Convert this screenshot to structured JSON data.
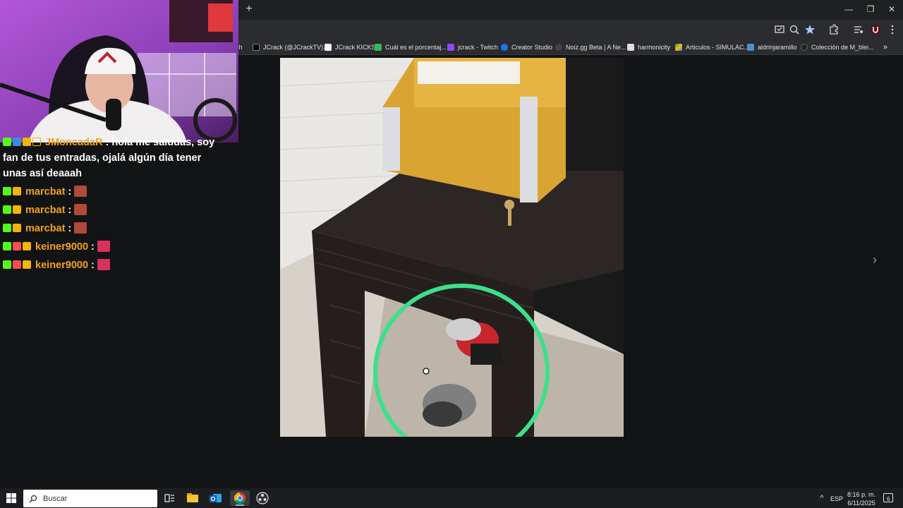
{
  "browser": {
    "new_tab_label": "+",
    "window_controls": {
      "minimize": "—",
      "restore": "❐",
      "close": "✕"
    },
    "toolbar_icons": [
      "cast-icon",
      "zoom-icon",
      "bookmark-star-icon",
      "extensions-icon",
      "media-icon",
      "profile-icon",
      "menu-icon"
    ],
    "bookmarks": [
      {
        "label": "ch",
        "icon": "twitch-icon"
      },
      {
        "label": "JCrack (@JCrackTV)...",
        "icon": "x-icon"
      },
      {
        "label": "JCrack KICKS",
        "icon": "kick-icon"
      },
      {
        "label": "Cuál es el porcentaj...",
        "icon": "page-icon"
      },
      {
        "label": "jcrack - Twitch",
        "icon": "twitch-icon"
      },
      {
        "label": "Creator Studio",
        "icon": "facebook-icon"
      },
      {
        "label": "Noiz.gg Beta | A Ne...",
        "icon": "noiz-icon"
      },
      {
        "label": "harmonicity",
        "icon": "page-icon"
      },
      {
        "label": "Articulos - SIMULAC...",
        "icon": "drive-icon"
      },
      {
        "label": "aldrinjaramillo",
        "icon": "page-icon"
      },
      {
        "label": "Colección de M_blei...",
        "icon": "page-icon"
      }
    ],
    "bookmarks_overflow": "»"
  },
  "viewer": {
    "next_label": "›"
  },
  "chat": {
    "messages": [
      {
        "user": "JMoncadaR",
        "separator": " : ",
        "text": "hola me saludas, soy"
      },
      {
        "continuation": "fan de tus entradas, ojalá algún día tener"
      },
      {
        "continuation": "unas así deaaah"
      },
      {
        "user": "marcbat",
        "separator": " : "
      },
      {
        "user": "marcbat",
        "separator": " : "
      },
      {
        "user": "marcbat",
        "separator": " : "
      },
      {
        "user": "keiner9000",
        "separator": " : "
      },
      {
        "user": "keiner9000",
        "separator": " : "
      }
    ]
  },
  "taskbar": {
    "search_placeholder": "Buscar",
    "language": "ESP",
    "time": "8:16 p. m.",
    "date": "6/11/2025",
    "notification_count": "6",
    "tray_chevron": "^"
  }
}
